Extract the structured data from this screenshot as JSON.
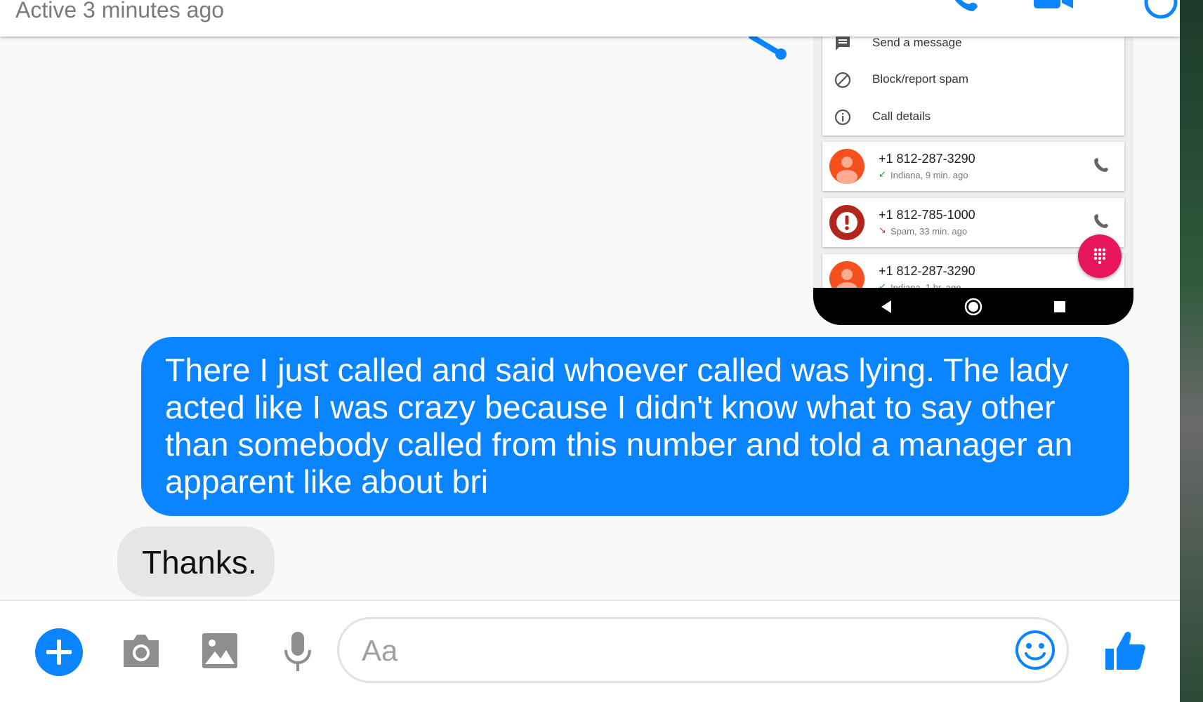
{
  "header": {
    "status": "Active 3 minutes ago"
  },
  "attachment": {
    "menu": [
      {
        "icon": "message-icon",
        "label": "Send a message"
      },
      {
        "icon": "block-icon",
        "label": "Block/report spam"
      },
      {
        "icon": "info-icon",
        "label": "Call details"
      }
    ],
    "calls": [
      {
        "number": "+1 812-287-3290",
        "detail": "Indiana, 9 min. ago",
        "type": "contact"
      },
      {
        "number": "+1 812-785-1000",
        "detail": "Spam, 33 min. ago",
        "type": "spam"
      },
      {
        "number": "+1 812-287-3290",
        "detail": "Indiana, 1 hr. ago",
        "type": "contact"
      }
    ]
  },
  "messages": {
    "sent": "There I just called and said whoever called was lying. The lady acted like I was crazy because I didn't know what to say other than somebody called from this number and told a manager an apparent like about bri",
    "received": "Thanks."
  },
  "composer": {
    "placeholder": "Aa"
  },
  "colors": {
    "messenger_blue": "#0a84ff",
    "fab_pink": "#e8175d",
    "avatar_orange": "#f4511e",
    "spam_red": "#b3261e"
  }
}
